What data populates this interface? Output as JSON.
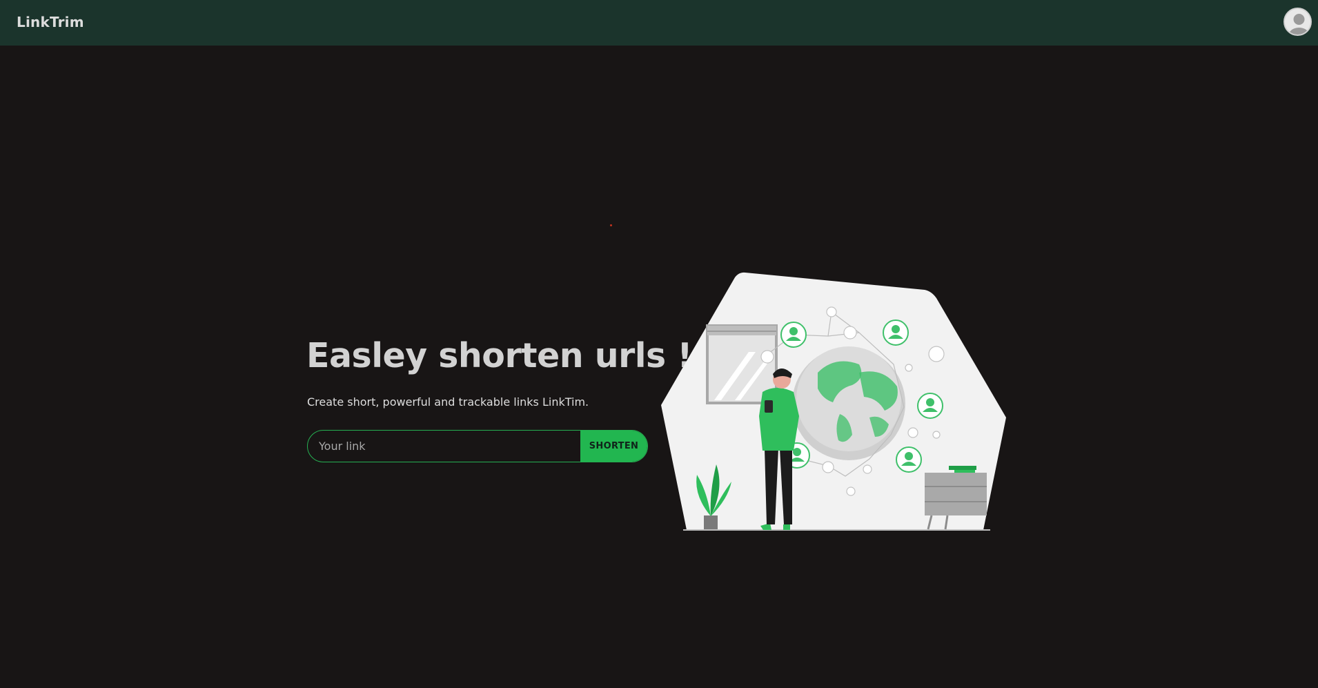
{
  "navbar": {
    "brand": "LinkTrim",
    "avatar_icon": "user-avatar-icon"
  },
  "hero": {
    "title": "Easley shorten urls !",
    "subtitle": "Create short, powerful and trackable links LinkTim."
  },
  "form": {
    "input_value": "",
    "input_placeholder": "Your link",
    "button_label": "SHORTEN"
  },
  "colors": {
    "navbar_bg": "#1b342c",
    "page_bg": "#181515",
    "accent": "#22b650",
    "text": "#d2d2d2"
  },
  "illustration": {
    "icon": "globe-network-person-illustration"
  }
}
